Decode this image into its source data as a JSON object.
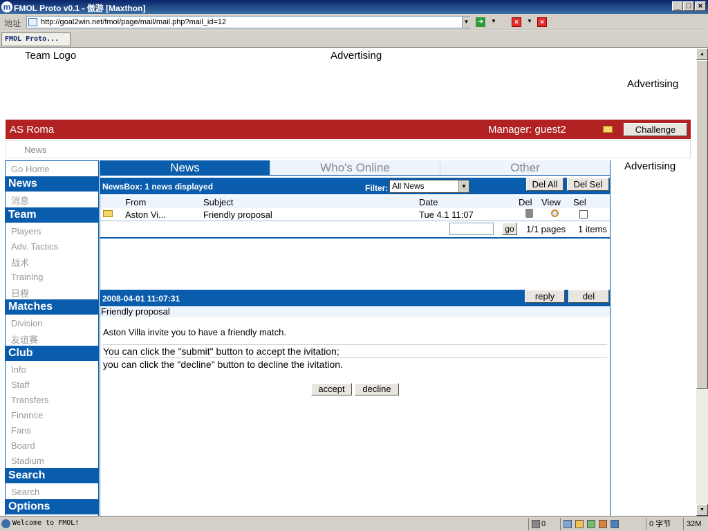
{
  "window": {
    "title": "FMOL Proto v0.1 - 傲游 [Maxthon]",
    "address_label": "地址",
    "url": "http://goal2win.net/fmol/page/mail/mail.php?mail_id=12",
    "tab_label": "FMOL Proto..."
  },
  "header": {
    "team_logo": "Team Logo",
    "ad_top": "Advertising",
    "ad_right": "Advertising",
    "club_name": "AS Roma",
    "manager": "Manager: guest2",
    "challenge_label": "Challenge",
    "breadcrumb_news": "News"
  },
  "menu": {
    "go_home": "Go Home",
    "sections": {
      "news": "News",
      "team": "Team",
      "matches": "Matches",
      "club": "Club",
      "search": "Search",
      "options": "Options"
    },
    "items": {
      "news_msgs": "消息",
      "players": "Players",
      "adv_tactics": "Adv. Tactics",
      "tactics_cn": "战术",
      "training": "Training",
      "schedule_cn": "日程",
      "division": "Division",
      "friendly_cn": "友谊赛",
      "info": "Info",
      "staff": "Staff",
      "transfers": "Transfers",
      "finance": "Finance",
      "fans": "Fans",
      "board": "Board",
      "stadium": "Stadium",
      "search": "Search"
    }
  },
  "tabs": {
    "news": "News",
    "whos_online": "Who's Online",
    "other": "Other"
  },
  "newsbox": {
    "title": "NewsBox:  1  news displayed",
    "filter_label": "Filter:",
    "filter_value": "All News",
    "del_all": "Del All",
    "del_sel": "Del Sel",
    "columns": {
      "from": "From",
      "subject": "Subject",
      "date": "Date",
      "del": "Del",
      "view": "View",
      "sel": "Sel"
    },
    "row": {
      "from": "Aston Vi...",
      "subject": "Friendly proposal",
      "date": "Tue 4.1 11:07"
    },
    "go": "go",
    "pages": "1/1 pages",
    "items": "1 items"
  },
  "message": {
    "datetime": "2008-04-01 11:07:31",
    "reply": "reply",
    "del": "del",
    "subject": "Friendly proposal",
    "body_line1": "Aston Villa invite you to have a friendly match.",
    "body_line2": "You can click the \"submit\" button to accept the ivitation;",
    "body_line3": "you can click the \"decline\" button to decline the ivitation.",
    "accept": "accept",
    "decline": "decline"
  },
  "side_ad": "Advertising",
  "status": {
    "message": "Welcome to FMOL!",
    "trash_count": "0",
    "bytes": "0 字节",
    "memory": "32M"
  }
}
